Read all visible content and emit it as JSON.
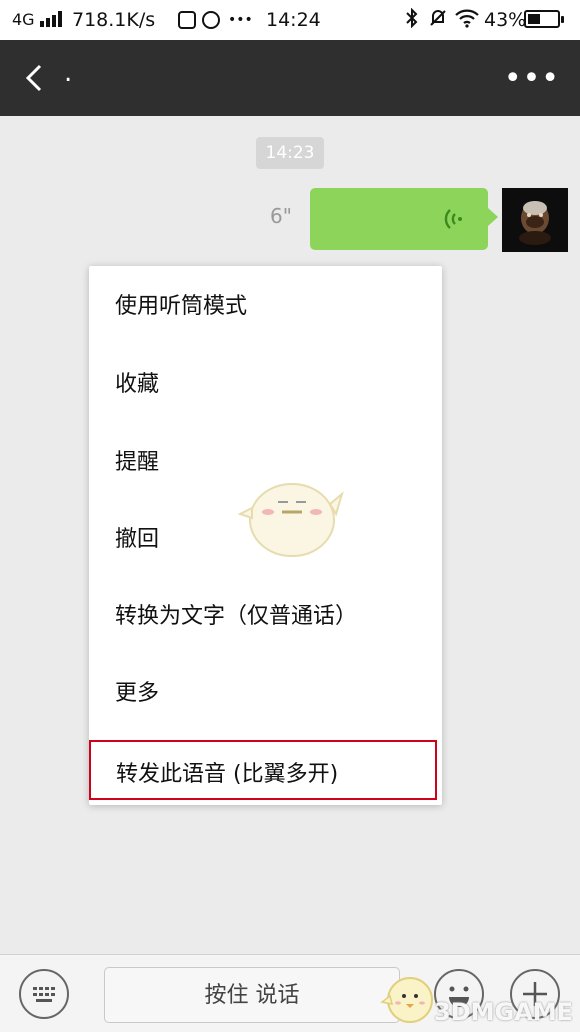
{
  "status_bar": {
    "network": "4G",
    "speed": "718.1K/s",
    "time": "14:24",
    "battery": "43%",
    "battery_level": 0.43,
    "more_glyph": "•••"
  },
  "title_bar": {
    "title": ".",
    "more_glyph": "•••"
  },
  "chat": {
    "timestamp": "14:23",
    "voice_message": {
      "duration": "6\""
    }
  },
  "context_menu": {
    "items": [
      {
        "label": "使用听筒模式"
      },
      {
        "label": "收藏"
      },
      {
        "label": "提醒"
      },
      {
        "label": "撤回"
      },
      {
        "label": "转换为文字（仅普通话）"
      },
      {
        "label": "更多"
      },
      {
        "label": "转发此语音 (比翼多开)"
      }
    ],
    "highlight_color": "#d0021b"
  },
  "input_bar": {
    "hold_to_talk": "按住 说话"
  },
  "watermark": {
    "text": "3DMGAME"
  },
  "colors": {
    "title_bar_bg": "#2f2f2f",
    "bubble": "#8cd45a",
    "chat_bg": "#ebebeb"
  }
}
